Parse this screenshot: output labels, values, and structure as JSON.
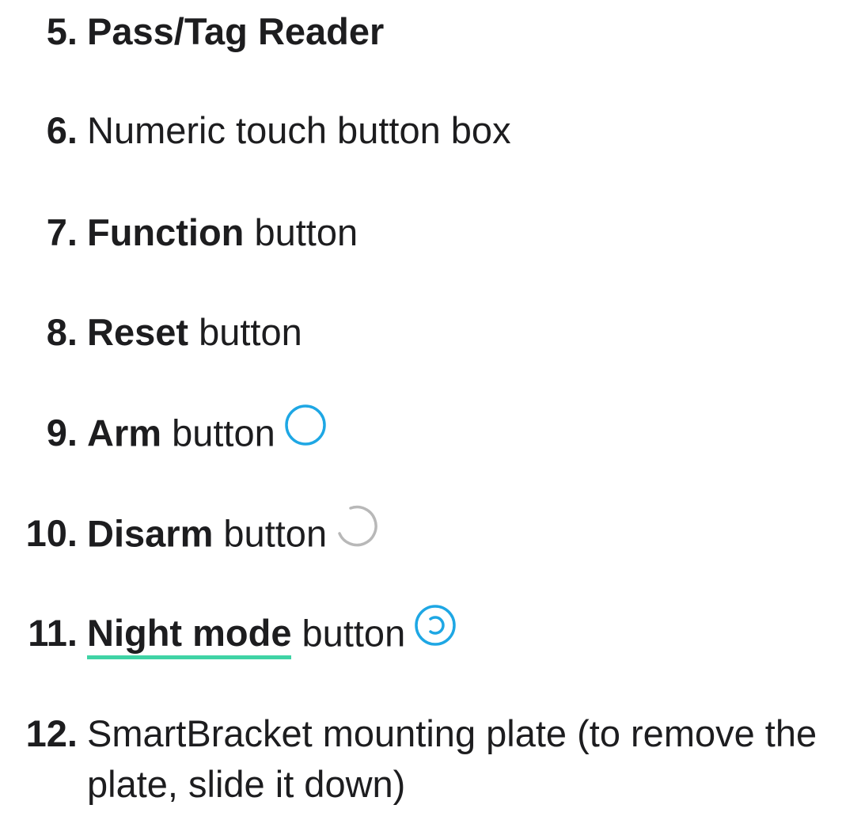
{
  "items": [
    {
      "number": "5.",
      "bold": "Pass/Tag Reader",
      "text": ""
    },
    {
      "number": "6.",
      "bold": "",
      "text": "Numeric touch button box"
    },
    {
      "number": "7.",
      "bold": "Function",
      "text": " button"
    },
    {
      "number": "8.",
      "bold": "Reset",
      "text": " button"
    },
    {
      "number": "9.",
      "bold": "Arm",
      "text": " button",
      "icon": "arm-circle-icon"
    },
    {
      "number": "10.",
      "bold": "Disarm",
      "text": " button",
      "icon": "disarm-broken-circle-icon"
    },
    {
      "number": "11.",
      "link": "Night mode",
      "text": " button",
      "icon": "night-mode-circle-icon"
    },
    {
      "number": "12.",
      "bold": "",
      "text": "SmartBracket mounting plate (to remove the plate, slide it down)"
    }
  ],
  "colors": {
    "text": "#1d1d1f",
    "arm_icon": "#1ea7e4",
    "disarm_icon": "#b8b8b8",
    "night_icon": "#1ea7e4",
    "link_underline": "#3fd3a5"
  }
}
